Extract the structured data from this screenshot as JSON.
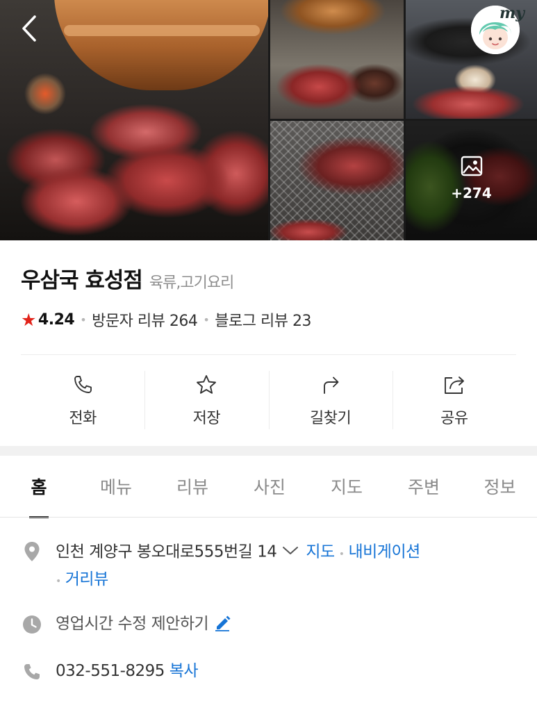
{
  "gallery": {
    "more_photos_count": "+274"
  },
  "header": {
    "profile_tag": "my"
  },
  "place": {
    "name": "우삼국 효성점",
    "category": "육류,고기요리",
    "rating": "4.24",
    "visitor_reviews": "방문자 리뷰 264",
    "blog_reviews": "블로그 리뷰 23"
  },
  "actions": [
    {
      "label": "전화",
      "icon": "phone-icon"
    },
    {
      "label": "저장",
      "icon": "star-outline-icon"
    },
    {
      "label": "길찾기",
      "icon": "directions-arrow-icon"
    },
    {
      "label": "공유",
      "icon": "share-icon"
    }
  ],
  "tabs": [
    "홈",
    "메뉴",
    "리뷰",
    "사진",
    "지도",
    "주변",
    "정보"
  ],
  "active_tab": "홈",
  "details": {
    "address": "인천 계양구 봉오대로555번길 14",
    "map_link": "지도",
    "navigation_link": "내비게이션",
    "street_view_link": "거리뷰",
    "hours_suggest": "영업시간 수정 제안하기",
    "phone": "032-551-8295",
    "copy_link": "복사"
  },
  "colors": {
    "link_blue": "#1674d6",
    "star_red": "#e2231a",
    "icon_gray": "#a8a8a8"
  }
}
